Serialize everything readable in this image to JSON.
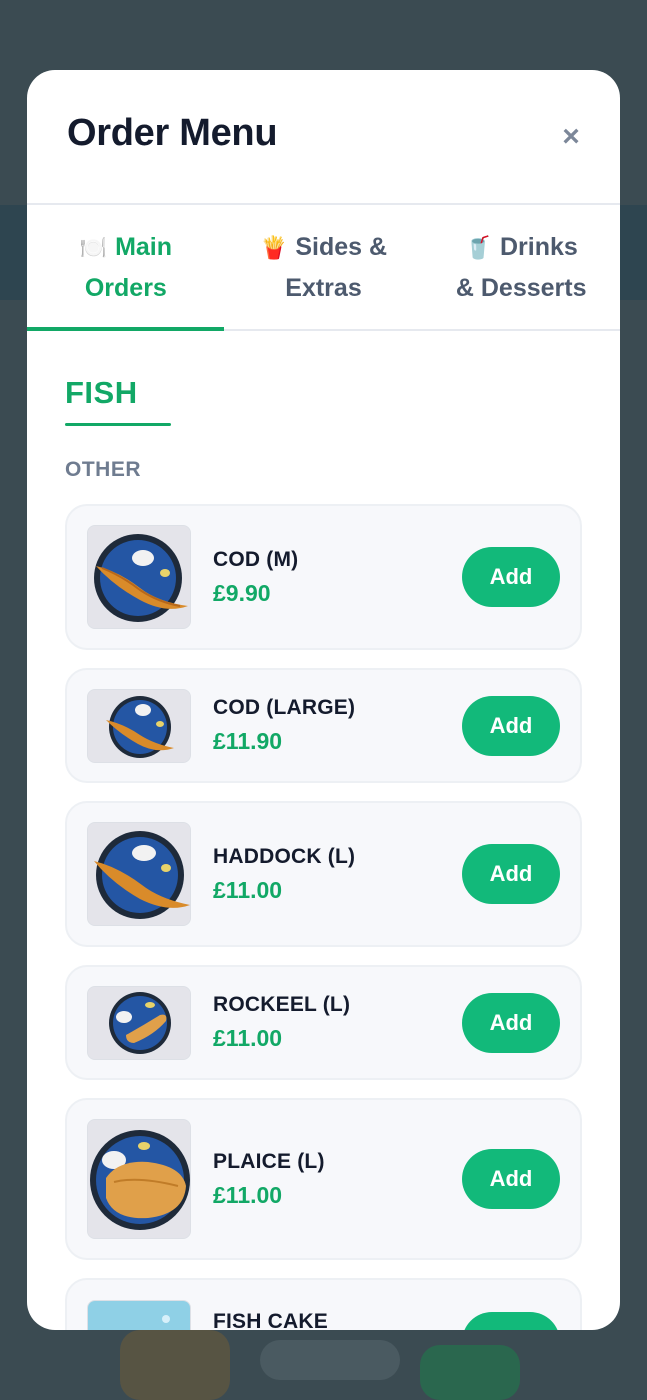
{
  "modal": {
    "title": "Order Menu",
    "close_symbol": "×"
  },
  "tabs": [
    {
      "emoji": "🍽️",
      "label": "Main Orders",
      "active": true
    },
    {
      "emoji": "🍟",
      "label": "Sides & Extras",
      "active": false
    },
    {
      "emoji": "🥤",
      "label": "Drinks & Desserts",
      "active": false
    }
  ],
  "section": {
    "title": "FISH",
    "subsection": "OTHER"
  },
  "items": [
    {
      "name": "COD (M)",
      "price": "£9.90",
      "button": "Add"
    },
    {
      "name": "COD (LARGE)",
      "price": "£11.90",
      "button": "Add"
    },
    {
      "name": "HADDOCK (L)",
      "price": "£11.00",
      "button": "Add"
    },
    {
      "name": "ROCKEEL (L)",
      "price": "£11.00",
      "button": "Add"
    },
    {
      "name": "PLAICE (L)",
      "price": "£11.00",
      "button": "Add"
    },
    {
      "name": "FISH CAKE",
      "price": "",
      "button": "Add"
    }
  ],
  "colors": {
    "accent": "#12a866",
    "button": "#12b97a",
    "title": "#141b2d",
    "overlay": "#3b4b52"
  }
}
